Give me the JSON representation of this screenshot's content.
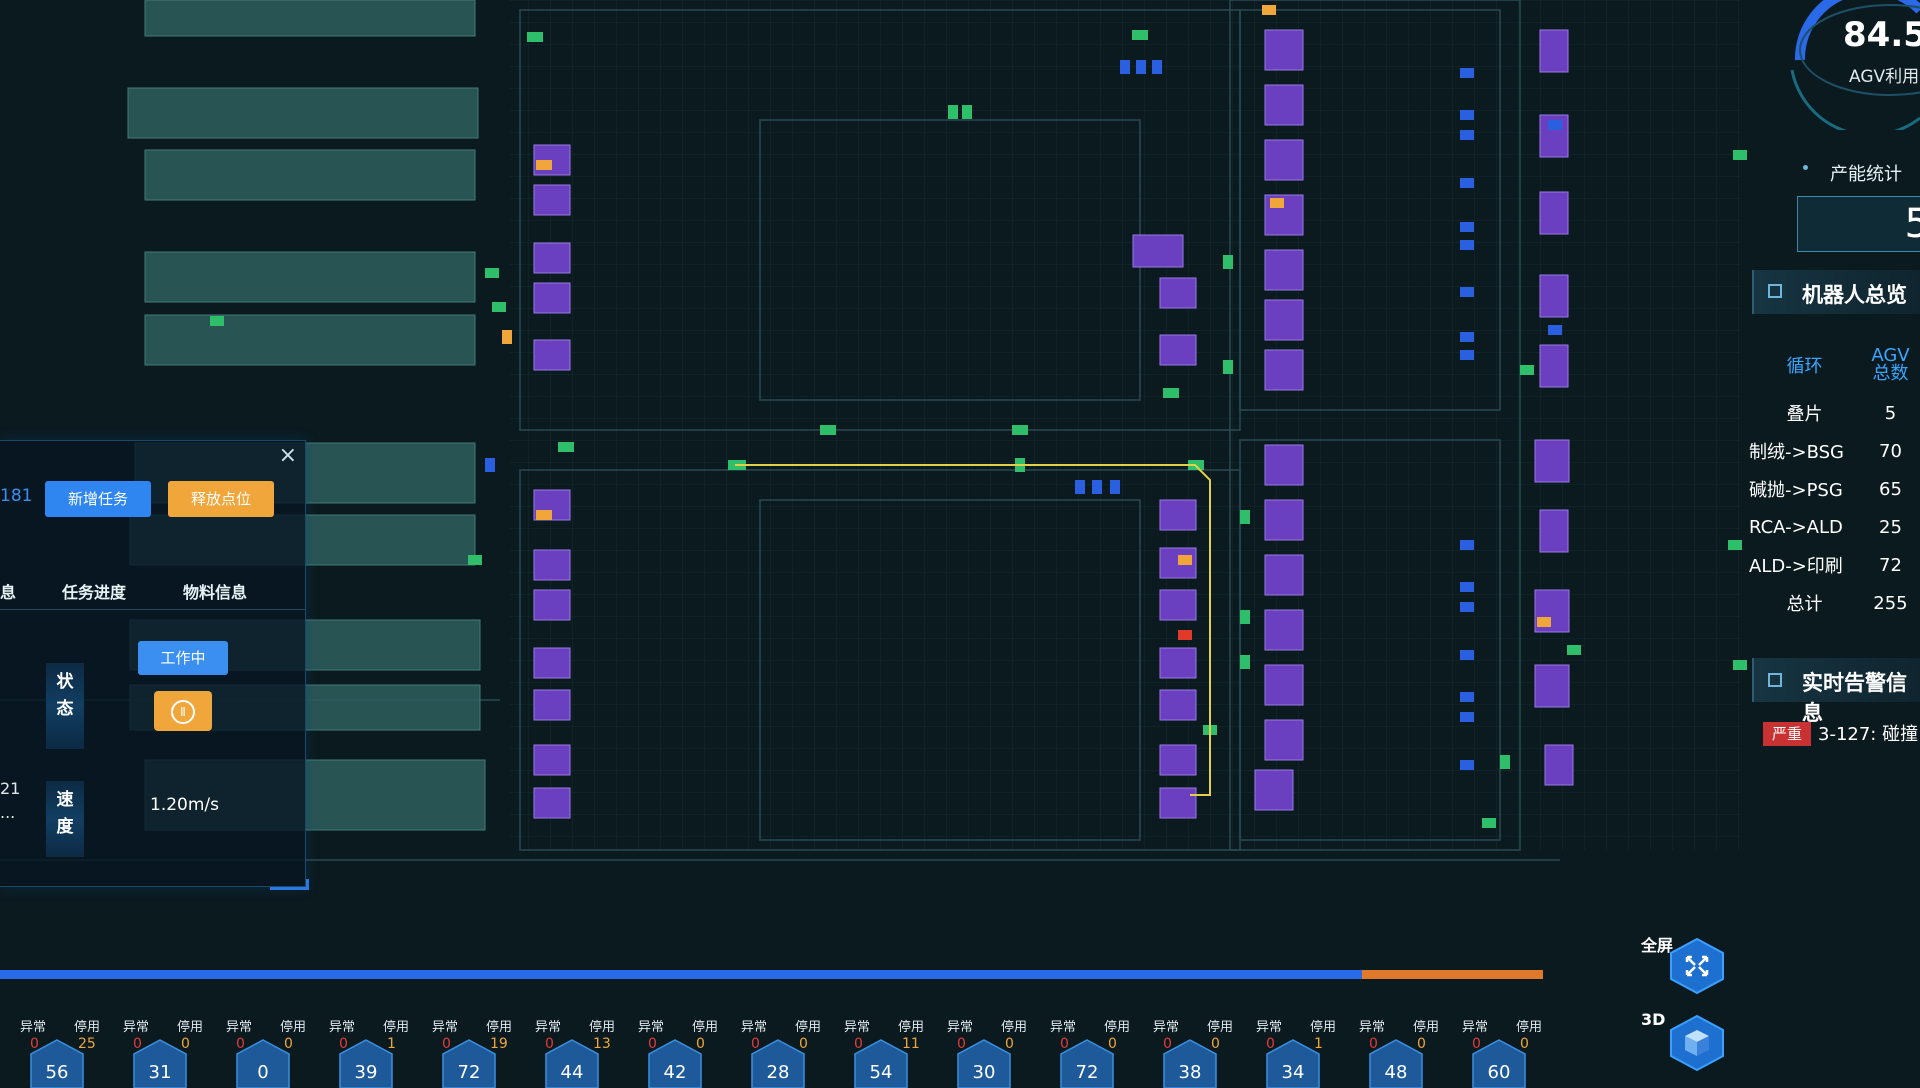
{
  "gauge": {
    "value": "84.5",
    "label": "AGV利用"
  },
  "capacity": {
    "label": "产能统计",
    "value": "5"
  },
  "robots": {
    "title": "机器人总览",
    "col_loop": "循环",
    "col_agv_line1": "AGV",
    "col_agv_line2": "总数",
    "rows": [
      {
        "name": "叠片",
        "count": "5"
      },
      {
        "name": "制绒->BSG",
        "count": "70"
      },
      {
        "name": "碱抛->PSG",
        "count": "65"
      },
      {
        "name": "RCA->ALD",
        "count": "25"
      },
      {
        "name": "ALD->印刷",
        "count": "72"
      },
      {
        "name": "总计",
        "count": "255"
      }
    ]
  },
  "alarms": {
    "title": "实时告警信息",
    "items": [
      {
        "level": "严重",
        "text": "3-127: 碰撞"
      }
    ]
  },
  "popup": {
    "id_fragment": "181",
    "new_task": "新增任务",
    "release_point": "释放点位",
    "tab_info_fragment": "息",
    "tab_progress": "任务进度",
    "tab_material": "物料信息",
    "status_label_1": "状",
    "status_label_2": "态",
    "status_value": "工作中",
    "pause_icon": "Ⅱ",
    "speed_label_1": "速",
    "speed_label_2": "度",
    "speed_value": "1.20m/s",
    "side_value": "21",
    "side_more": "..."
  },
  "progress": {
    "blue_fraction": 0.883,
    "orange_fraction": 0.117
  },
  "stats": {
    "abnormal_label": "异常",
    "stopped_label": "停用",
    "items": [
      {
        "abnormal": "0",
        "stopped": "25",
        "total": "56"
      },
      {
        "abnormal": "0",
        "stopped": "0",
        "total": "31"
      },
      {
        "abnormal": "0",
        "stopped": "0",
        "total": "0"
      },
      {
        "abnormal": "0",
        "stopped": "1",
        "total": "39"
      },
      {
        "abnormal": "0",
        "stopped": "19",
        "total": "72"
      },
      {
        "abnormal": "0",
        "stopped": "13",
        "total": "44"
      },
      {
        "abnormal": "0",
        "stopped": "0",
        "total": "42"
      },
      {
        "abnormal": "0",
        "stopped": "0",
        "total": "28"
      },
      {
        "abnormal": "0",
        "stopped": "11",
        "total": "54"
      },
      {
        "abnormal": "0",
        "stopped": "0",
        "total": "30"
      },
      {
        "abnormal": "0",
        "stopped": "0",
        "total": "72"
      },
      {
        "abnormal": "0",
        "stopped": "0",
        "total": "38"
      },
      {
        "abnormal": "0",
        "stopped": "1",
        "total": "34"
      },
      {
        "abnormal": "0",
        "stopped": "0",
        "total": "48"
      },
      {
        "abnormal": "0",
        "stopped": "0",
        "total": "60"
      }
    ]
  },
  "controls": {
    "fullscreen": "全屏",
    "three_d": "3D"
  },
  "colors": {
    "accent_blue": "#2f86f0",
    "accent_orange": "#f0a63a",
    "agv_purple": "#6a3fc0",
    "agv_green": "#2fbf6a",
    "alarm_red": "#c83232"
  }
}
